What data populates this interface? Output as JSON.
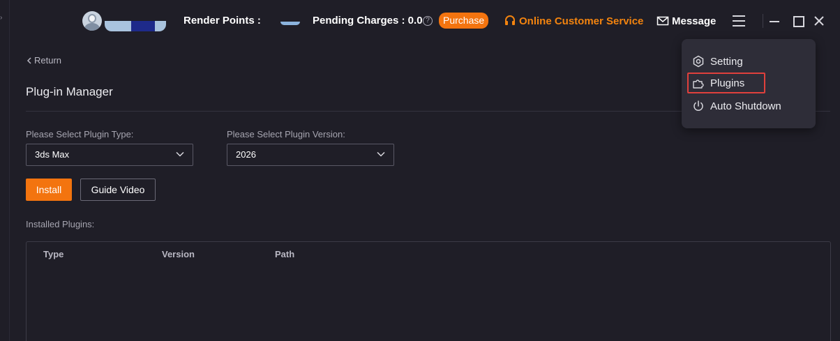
{
  "topbar": {
    "render_points_label": "Render Points :",
    "pending_charges_label": "Pending Charges : 0.0",
    "help_glyph": "?",
    "purchase_label": "Purchase",
    "customer_service_label": "Online Customer Service",
    "message_label": "Message",
    "icons": {
      "avatar": "avatar-icon",
      "help": "question-circle-icon",
      "service": "headset-icon",
      "message": "envelope-icon",
      "menu": "hamburger-menu-icon",
      "minimize": "minimize-icon",
      "maximize": "maximize-icon",
      "close": "close-icon"
    }
  },
  "content": {
    "return_label": "Return",
    "page_title": "Plug-in Manager",
    "plugin_type_label": "Please Select Plugin Type:",
    "plugin_type_value": "3ds Max",
    "plugin_version_label": "Please Select Plugin Version:",
    "plugin_version_value": "2026",
    "install_label": "Install",
    "guide_video_label": "Guide Video",
    "installed_label": "Installed Plugins:",
    "table": {
      "columns": [
        "Type",
        "Version",
        "Path"
      ],
      "rows": []
    }
  },
  "menu": {
    "items": [
      {
        "label": "Setting",
        "icon": "gear-icon"
      },
      {
        "label": "Plugins",
        "icon": "puzzle-icon",
        "highlighted": true
      },
      {
        "label": "Auto Shutdown",
        "icon": "power-icon"
      }
    ]
  },
  "colors": {
    "background": "#1f1e27",
    "accent": "#f3740f",
    "accent_text": "#f3840f",
    "menu_background": "#2e2d38",
    "highlight_border": "#e0403c"
  }
}
